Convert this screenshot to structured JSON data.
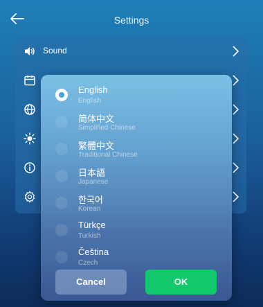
{
  "header": {
    "title": "Settings",
    "back_icon": "arrow-left-icon"
  },
  "settings_list": [
    {
      "label": "Sound",
      "icon": "speaker-icon"
    },
    {
      "label": "",
      "icon": "calendar-icon"
    },
    {
      "label": "",
      "icon": "globe-icon"
    },
    {
      "label": "",
      "icon": "brightness-icon"
    },
    {
      "label": "",
      "icon": "info-icon"
    },
    {
      "label": "",
      "icon": "gear-icon"
    }
  ],
  "language_dialog": {
    "options": [
      {
        "native": "English",
        "english": "English",
        "selected": true
      },
      {
        "native": "简体中文",
        "english": "Simplified Chinese",
        "selected": false
      },
      {
        "native": "繁體中文",
        "english": "Traditional Chinese",
        "selected": false
      },
      {
        "native": "日本語",
        "english": "Japanese",
        "selected": false
      },
      {
        "native": "한국어",
        "english": "Korean",
        "selected": false
      },
      {
        "native": "Türkçe",
        "english": "Turkish",
        "selected": false
      },
      {
        "native": "Čeština",
        "english": "Czech",
        "selected": false
      }
    ],
    "cancel_label": "Cancel",
    "ok_label": "OK"
  },
  "colors": {
    "ok_button": "#13c76c",
    "selected_radio": "#ffffff"
  }
}
